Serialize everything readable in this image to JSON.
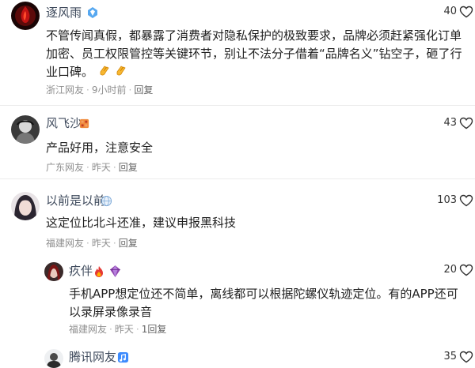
{
  "comments": [
    {
      "name": "逐风雨",
      "likes": "40",
      "text": "不管传闻真假，都暴露了消费者对隐私保护的极致要求，品牌必须赶紧强化订单加密、员工权限管控等关键环节，别让不法分子借着“品牌名义”钻空子，砸了行业口碑。",
      "location": "浙江网友",
      "time": "9小时前",
      "reply": "回复",
      "badge_icon": "diamond-badge-icon",
      "emoji_icons": [
        "clapping-hands-emoji-icon",
        "clapping-hands-emoji-icon"
      ]
    },
    {
      "name": "风飞沙",
      "likes": "43",
      "text": "产品好用，注意安全",
      "location": "广东网友",
      "time": "昨天",
      "reply": "回复",
      "badge_icon": "cube-badge-icon"
    },
    {
      "name": "以前是以前",
      "likes": "103",
      "text": "这定位比北斗还准，建议申报黑科技",
      "location": "福建网友",
      "time": "昨天",
      "reply": "回复",
      "badge_icon": "globe-badge-icon"
    },
    {
      "name": "疚伴",
      "likes": "20",
      "text": "手机APP想定位还不简单，离线都可以根据陀螺仪轨迹定位。有的APP还可以录屏录像录音",
      "location": "福建网友",
      "time": "昨天",
      "reply": "1回复",
      "badge_icons": [
        "flame-badge-icon",
        "purple-gem-badge-icon"
      ]
    },
    {
      "name": "腾讯网友",
      "likes": "35",
      "badge_icon": "blue-music-badge-icon"
    }
  ],
  "colors": {
    "name": "#3e4a5c",
    "meta": "#8f8f8f",
    "text": "#1f1f1f",
    "divider": "#ececec"
  }
}
